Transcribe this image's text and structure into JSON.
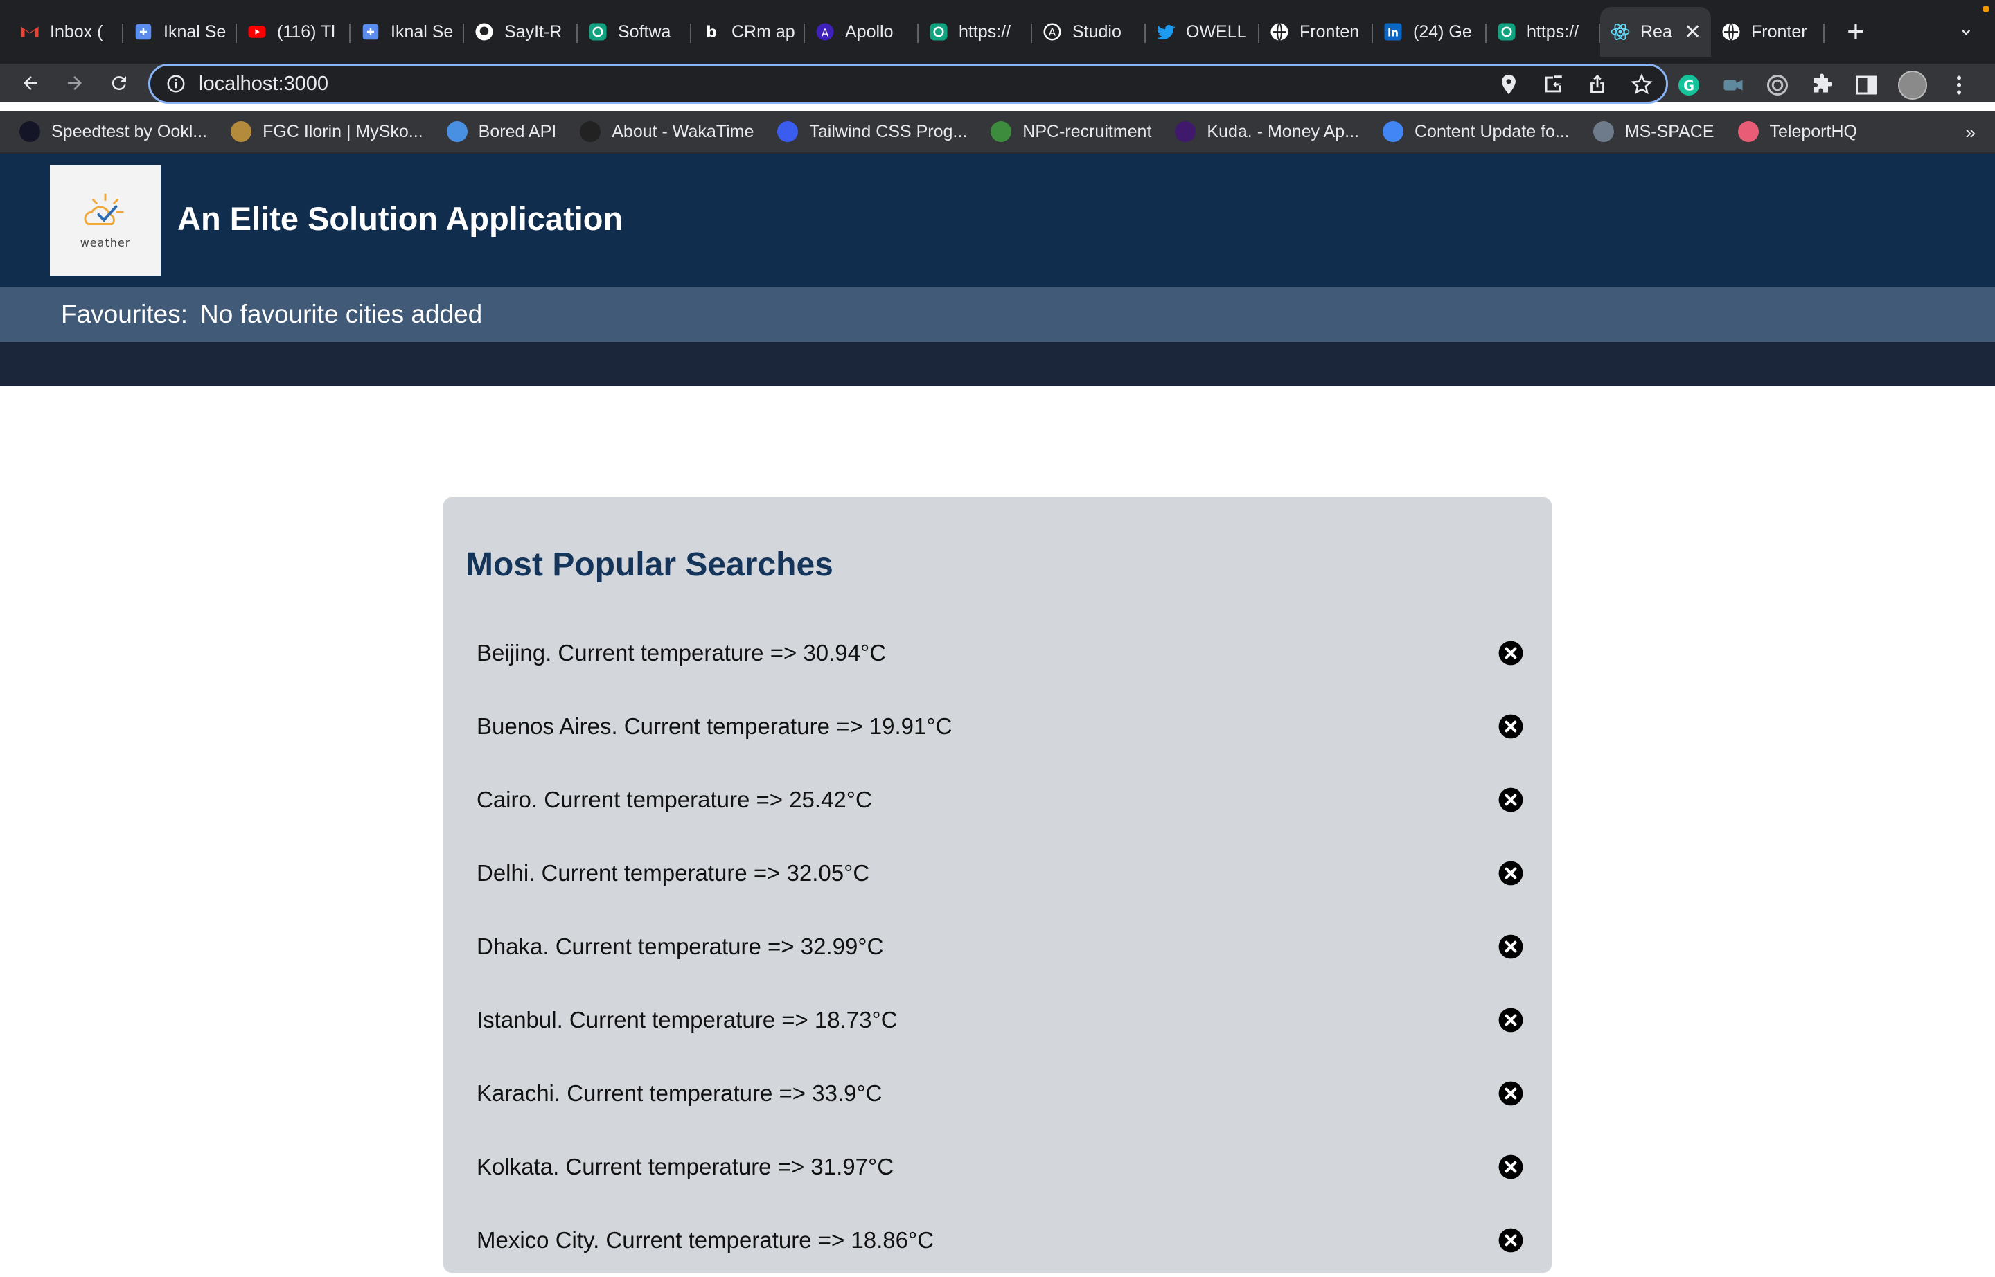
{
  "browser": {
    "tabs": [
      {
        "title": "Inbox (",
        "icon": "gmail-icon",
        "color": "#ea4335"
      },
      {
        "title": "Iknal Se",
        "icon": "iknal-icon",
        "color": "#5b8def"
      },
      {
        "title": "(116) Tl",
        "icon": "youtube-icon",
        "color": "#ff0000"
      },
      {
        "title": "Iknal Se",
        "icon": "iknal-icon",
        "color": "#5b8def"
      },
      {
        "title": "SayIt-R",
        "icon": "github-icon",
        "color": "#ffffff"
      },
      {
        "title": "Softwa",
        "icon": "chatgpt-icon",
        "color": "#10a37f"
      },
      {
        "title": "CRm ap",
        "icon": "b-icon",
        "color": "#ffffff"
      },
      {
        "title": "Apollo",
        "icon": "apollo-icon",
        "color": "#3f20ba"
      },
      {
        "title": "https://",
        "icon": "chatgpt-icon",
        "color": "#10a37f"
      },
      {
        "title": "Studio",
        "icon": "studio-icon",
        "color": "#ffffff"
      },
      {
        "title": "OWELL",
        "icon": "twitter-icon",
        "color": "#1d9bf0"
      },
      {
        "title": "Fronten",
        "icon": "globe-icon",
        "color": "#ffffff"
      },
      {
        "title": "(24) Ge",
        "icon": "linkedin-icon",
        "color": "#0a66c2"
      },
      {
        "title": "https://",
        "icon": "chatgpt-icon",
        "color": "#10a37f"
      },
      {
        "title": "Rea",
        "icon": "react-icon",
        "color": "#61dafb",
        "active": true
      },
      {
        "title": "Fronter",
        "icon": "globe-icon",
        "color": "#ffffff"
      }
    ],
    "new_tab_label": "+",
    "url": "localhost:3000",
    "bookmarks": [
      {
        "label": "Speedtest by Ookl...",
        "icon": "speedtest-icon",
        "color": "#141526"
      },
      {
        "label": "FGC Ilorin | MySko...",
        "icon": "school-icon",
        "color": "#b48a3c"
      },
      {
        "label": "Bored API",
        "icon": "bored-api-icon",
        "color": "#4a90e2"
      },
      {
        "label": "About - WakaTime",
        "icon": "wakatime-icon",
        "color": "#222222"
      },
      {
        "label": "Tailwind CSS Prog...",
        "icon": "tailwind-icon",
        "color": "#3a5df0"
      },
      {
        "label": "NPC-recruitment",
        "icon": "npc-icon",
        "color": "#3d8b3d"
      },
      {
        "label": "Kuda. - Money Ap...",
        "icon": "kuda-icon",
        "color": "#40196d"
      },
      {
        "label": "Content Update fo...",
        "icon": "docs-icon",
        "color": "#4285f4"
      },
      {
        "label": "MS-SPACE",
        "icon": "ms-space-icon",
        "color": "#6e7b8b"
      },
      {
        "label": "TeleportHQ",
        "icon": "teleport-icon",
        "color": "#e85d75"
      }
    ],
    "bookmarks_more": "»"
  },
  "app": {
    "logo_text": "weather",
    "title_prefix": "An",
    "title_bold": "Elite",
    "title_suffix": "Solution Application",
    "favourites_label": "Favourites:",
    "favourites_value": "No favourite cities added",
    "popular_title": "Most Popular Searches",
    "cities": [
      {
        "name": "Beijing",
        "text": "Beijing. Current temperature => 30.94°C"
      },
      {
        "name": "Buenos Aires",
        "text": "Buenos Aires. Current temperature => 19.91°C"
      },
      {
        "name": "Cairo",
        "text": "Cairo. Current temperature => 25.42°C"
      },
      {
        "name": "Delhi",
        "text": "Delhi. Current temperature => 32.05°C"
      },
      {
        "name": "Dhaka",
        "text": "Dhaka. Current temperature => 32.99°C"
      },
      {
        "name": "Istanbul",
        "text": "Istanbul. Current temperature => 18.73°C"
      },
      {
        "name": "Karachi",
        "text": "Karachi. Current temperature => 33.9°C"
      },
      {
        "name": "Kolkata",
        "text": "Kolkata. Current temperature => 31.97°C"
      },
      {
        "name": "Mexico City",
        "text": "Mexico City. Current temperature => 18.86°C"
      }
    ]
  },
  "colors": {
    "header_bg": "#112d4e",
    "favourites_bg": "#415a77",
    "band_bg": "#1b263b",
    "card_bg": "#d3d7dc",
    "title_color": "#15345a"
  }
}
